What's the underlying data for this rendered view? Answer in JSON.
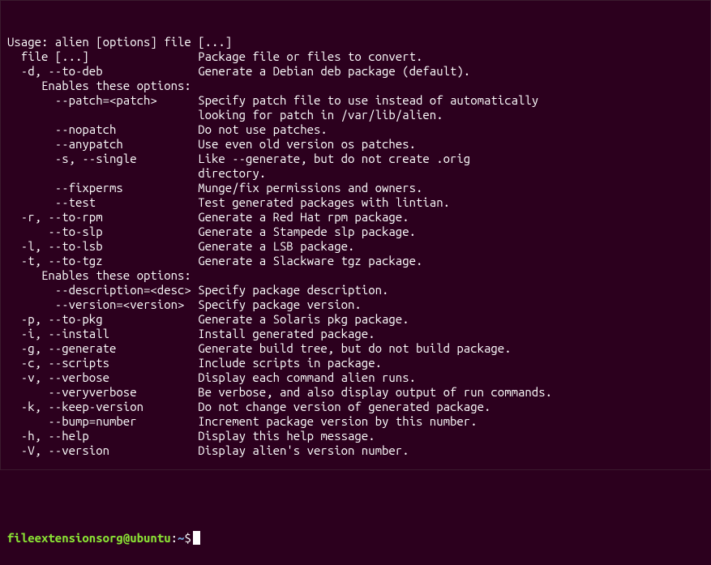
{
  "lines": [
    "Usage: alien [options] file [...]",
    "  file [...]                Package file or files to convert.",
    "  -d, --to-deb              Generate a Debian deb package (default).",
    "     Enables these options:",
    "       --patch=<patch>      Specify patch file to use instead of automatically",
    "                            looking for patch in /var/lib/alien.",
    "       --nopatch            Do not use patches.",
    "       --anypatch           Use even old version os patches.",
    "       -s, --single         Like --generate, but do not create .orig",
    "                            directory.",
    "       --fixperms           Munge/fix permissions and owners.",
    "       --test               Test generated packages with lintian.",
    "  -r, --to-rpm              Generate a Red Hat rpm package.",
    "      --to-slp              Generate a Stampede slp package.",
    "  -l, --to-lsb              Generate a LSB package.",
    "  -t, --to-tgz              Generate a Slackware tgz package.",
    "     Enables these options:",
    "       --description=<desc> Specify package description.",
    "       --version=<version>  Specify package version.",
    "  -p, --to-pkg              Generate a Solaris pkg package.",
    "  -i, --install             Install generated package.",
    "  -g, --generate            Generate build tree, but do not build package.",
    "  -c, --scripts             Include scripts in package.",
    "  -v, --verbose             Display each command alien runs.",
    "      --veryverbose         Be verbose, and also display output of run commands.",
    "  -k, --keep-version        Do not change version of generated package.",
    "      --bump=number         Increment package version by this number.",
    "  -h, --help                Display this help message.",
    "  -V, --version             Display alien's version number."
  ],
  "prompt": {
    "user": "fileextensionsorg",
    "host": "ubuntu",
    "path": "~",
    "symbol": "$"
  }
}
